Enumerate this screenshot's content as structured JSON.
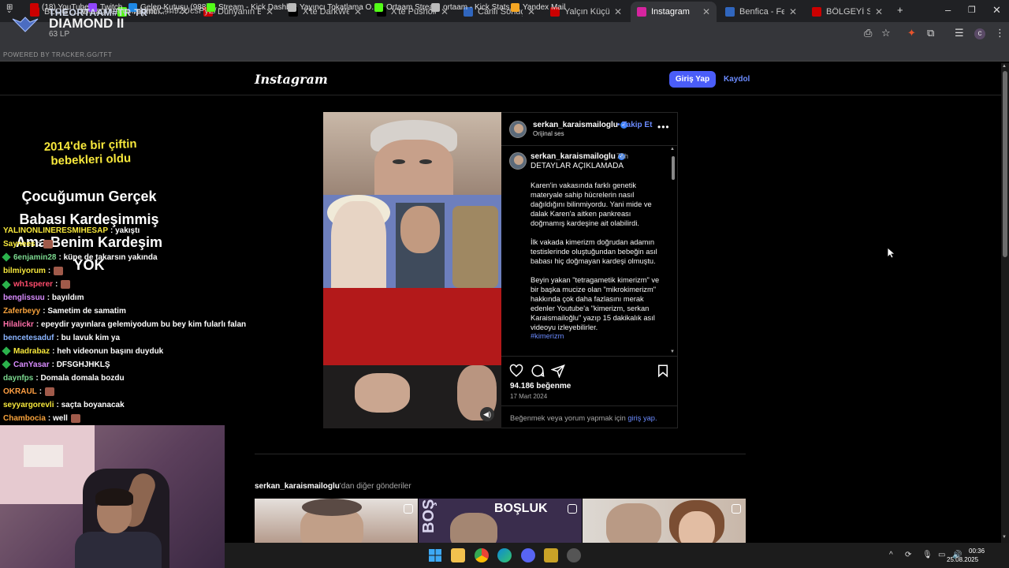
{
  "browser": {
    "tabs": [
      {
        "label": "BLOG ... iz HTSCA...",
        "icon": "youtube-icon",
        "color": "#c00"
      },
      {
        "label": "Yayıncı... - Kick Da...",
        "icon": "kick-icon",
        "color": "#53fc18"
      },
      {
        "label": "Dünyanın En Tatlı...",
        "icon": "youtube-icon",
        "color": "#c00"
      },
      {
        "label": "X'te DarkWeb Hab...",
        "icon": "x-icon",
        "color": "#000"
      },
      {
        "label": "X'te Pusholder: \"G...",
        "icon": "x-icon",
        "color": "#000"
      },
      {
        "label": "Canlı Sonuçlar, idd...",
        "icon": "mackolik-icon",
        "color": "#3066be"
      },
      {
        "label": "Yalçın Küçük gaze...",
        "icon": "youtube-icon",
        "color": "#c00"
      },
      {
        "label": "Instagram",
        "icon": "instagram-icon",
        "color": "#d6249f"
      },
      {
        "label": "Benfica - Fenerbah...",
        "icon": "mackolik-icon",
        "color": "#3066be"
      },
      {
        "label": "BÖLGEYİ SARSACA...",
        "icon": "youtube-icon",
        "color": "#c00"
      }
    ],
    "url": "instagram.com/reel/C4n92UcsPyZ/",
    "bookmarks": [
      {
        "label": "(18) YouTube",
        "color": "#c00"
      },
      {
        "label": "Twitch",
        "color": "#9146ff"
      },
      {
        "label": "Gelen Kutusu (988)...",
        "color": "#1e88e5"
      },
      {
        "label": "Stream - Kick Dashb...",
        "color": "#53fc18"
      },
      {
        "label": "Yayıncı Tokatlama O...",
        "color": "#bbbbbb"
      },
      {
        "label": "Ortaam Stream",
        "color": "#53fc18"
      },
      {
        "label": "ortaam - Kick Stats,...",
        "color": "#bbbbbb"
      },
      {
        "label": "Yandex Mail",
        "color": "#f5a623"
      }
    ]
  },
  "overlay": {
    "rank_name": "THEORTAAM#TR TR",
    "rank_tier": "DIAMOND II",
    "rank_lp": "63 LP",
    "powered": "POWERED BY TRACKER.GG/TFT"
  },
  "instagram": {
    "logo": "Instagram",
    "login_label": "Giriş Yap",
    "signup_label": "Kaydol",
    "post": {
      "username": "serkan_karaismailoglu",
      "follow_label": "Takip Et",
      "audio_label": "Orijinal ses",
      "time": "75h",
      "title": "DETAYLAR AÇIKLAMADA",
      "paragraphs": [
        "Karen'in vakasında farklı genetik materyale sahip hücrelerin nasıl dağıldığını bilinmiyordu. Yani mide ve dalak Karen'a aitken pankreası doğmamış kardeşine ait olabilirdi.",
        "İlk vakada kimerizm doğrudan adamın testislerinde oluştuğundan bebeğin asıl babası hiç doğmayan kardeşi olmuştu.",
        "Beyin yakan \"tetragametik kimerizm\" ve bir başka mucize olan \"mikrokimerizm\" hakkında çok daha fazlasını merak edenler Youtube'a \"kimerizm, serkan Karaismailoğlu\" yazıp 15 dakikalık asıl videoyu izleyebilirler."
      ],
      "hashtag": "#kimerizm",
      "likes": "94.186 beğenme",
      "date": "17 Mart 2024",
      "login_prompt": "Beğenmek veya yorum yapmak için",
      "login_prompt_link": "giriş yap."
    },
    "media": {
      "yellow_text": "2014'de bir çiftin bebekleri oldu",
      "white_text": "Çocuğumun Gerçek Babası Kardeşimmiş Ama Benim Kardeşim YOK"
    },
    "more_from_user": "serkan_karaismailoglu",
    "more_from_suffix": "'dan diğer gönderiler",
    "thumb_texts": [
      "BOŞLUK",
      "BOŞLUK"
    ]
  },
  "chat": [
    {
      "user": "YALINONLINERESMIHESAP",
      "msg": ": yakıştı",
      "color": "#f7e83c",
      "badge": false,
      "emote": false
    },
    {
      "user": "Saynees",
      "msg": ":",
      "color": "#f7e83c",
      "badge": false,
      "emote": true
    },
    {
      "user": "6enjamin28",
      "msg": ": küpe de takarsın yakında",
      "color": "#7bd88f",
      "badge": true,
      "emote": false
    },
    {
      "user": "bilmiyorum",
      "msg": ":",
      "color": "#f7e83c",
      "badge": false,
      "emote": true
    },
    {
      "user": "wh1sperer",
      "msg": ":",
      "color": "#ff4d6d",
      "badge": true,
      "emote": true
    },
    {
      "user": "benglissuu",
      "msg": ": bayıldım",
      "color": "#d98cff",
      "badge": false,
      "emote": false
    },
    {
      "user": "Zaferbeyy",
      "msg": ": Sametim de samatim",
      "color": "#f7a23c",
      "badge": false,
      "emote": false
    },
    {
      "user": "Hilalickr",
      "msg": ": epeydir yayınlara gelemiyodum bu bey kim fularlı falan",
      "color": "#ff6fa8",
      "badge": false,
      "emote": false
    },
    {
      "user": "bencetesaduf",
      "msg": ": bu lavuk kim ya",
      "color": "#8ab4ff",
      "badge": false,
      "emote": false
    },
    {
      "user": "Madrabaz",
      "msg": ": heh videonun başını duyduk",
      "color": "#f7e83c",
      "badge": true,
      "emote": false
    },
    {
      "user": "CanYasar",
      "msg": ": DFSGHJHKLŞ",
      "color": "#d98cff",
      "badge": true,
      "emote": false
    },
    {
      "user": "daynfps",
      "msg": ": Domala domala bozdu",
      "color": "#7bd88f",
      "badge": false,
      "emote": false
    },
    {
      "user": "OKRAUL",
      "msg": ":",
      "color": "#ff9f43",
      "badge": false,
      "emote": true
    },
    {
      "user": "seyyargorevli",
      "msg": ": saçta boyanacak",
      "color": "#f7e83c",
      "badge": false,
      "emote": false
    },
    {
      "user": "Chambocia",
      "msg": ": well",
      "color": "#f7a23c",
      "badge": false,
      "emote": true
    }
  ],
  "taskbar": {
    "time": "00:36",
    "date": "25.08.2025"
  }
}
